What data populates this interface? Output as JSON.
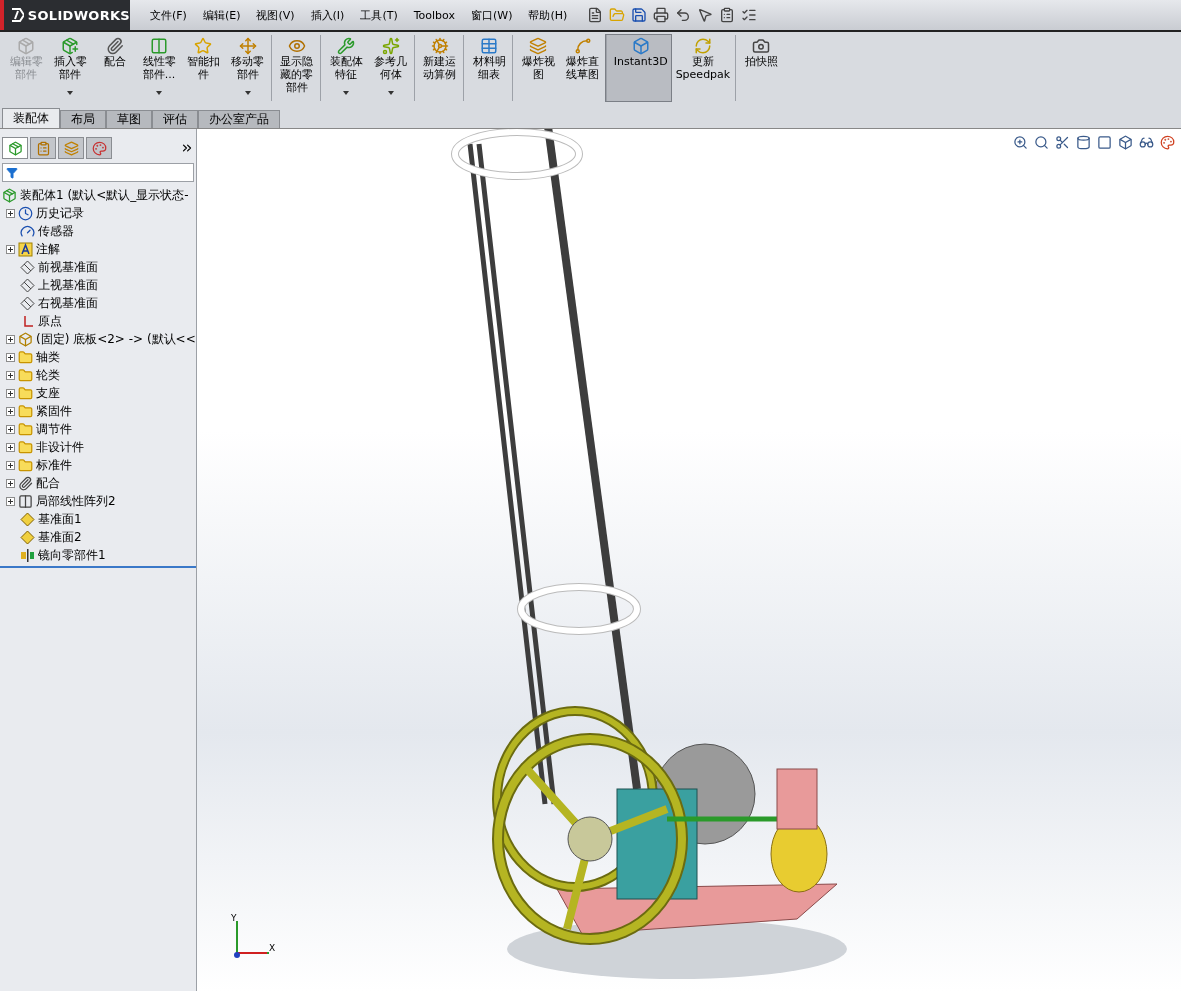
{
  "app": {
    "brand": "SOLIDWORKS"
  },
  "menu": [
    "文件(F)",
    "编辑(E)",
    "视图(V)",
    "插入(I)",
    "工具(T)",
    "Toolbox",
    "窗口(W)",
    "帮助(H)"
  ],
  "commands": [
    {
      "label": "编辑零部件",
      "disabled": true,
      "dropdown": false,
      "selected": false,
      "separator_before": false
    },
    {
      "label": "插入零部件",
      "disabled": false,
      "dropdown": true,
      "selected": false,
      "separator_before": false
    },
    {
      "label": "配合",
      "disabled": false,
      "dropdown": false,
      "selected": false,
      "separator_before": false
    },
    {
      "label": "线性零部件...",
      "disabled": false,
      "dropdown": true,
      "selected": false,
      "separator_before": false
    },
    {
      "label": "智能扣件",
      "disabled": false,
      "dropdown": false,
      "selected": false,
      "separator_before": false
    },
    {
      "label": "移动零部件",
      "disabled": false,
      "dropdown": true,
      "selected": false,
      "separator_before": false
    },
    {
      "label": "显示隐藏的零部件",
      "disabled": false,
      "dropdown": false,
      "selected": false,
      "separator_before": true
    },
    {
      "label": "装配体特征",
      "disabled": false,
      "dropdown": true,
      "selected": false,
      "separator_before": true
    },
    {
      "label": "参考几何体",
      "disabled": false,
      "dropdown": true,
      "selected": false,
      "separator_before": false
    },
    {
      "label": "新建运动算例",
      "disabled": false,
      "dropdown": false,
      "selected": false,
      "separator_before": true
    },
    {
      "label": "材料明细表",
      "disabled": false,
      "dropdown": false,
      "selected": false,
      "separator_before": true
    },
    {
      "label": "爆炸视图",
      "disabled": false,
      "dropdown": false,
      "selected": false,
      "separator_before": true
    },
    {
      "label": "爆炸直线草图",
      "disabled": false,
      "dropdown": false,
      "selected": false,
      "separator_before": false
    },
    {
      "label": "Instant3D",
      "disabled": false,
      "dropdown": false,
      "selected": true,
      "separator_before": true
    },
    {
      "label": "更新Speedpak",
      "disabled": false,
      "dropdown": false,
      "selected": false,
      "separator_before": false
    },
    {
      "label": "拍快照",
      "disabled": false,
      "dropdown": false,
      "selected": false,
      "separator_before": true
    }
  ],
  "tabs": [
    {
      "label": "装配体",
      "selected": true
    },
    {
      "label": "布局",
      "selected": false
    },
    {
      "label": "草图",
      "selected": false
    },
    {
      "label": "评估",
      "selected": false
    },
    {
      "label": "办公室产品",
      "selected": false
    }
  ],
  "panel_tabs": [
    {
      "selected": true
    },
    {
      "selected": false
    },
    {
      "selected": false
    },
    {
      "selected": false
    }
  ],
  "tree": {
    "label": "装配体1 (默认<默认_显示状态-",
    "kind": "assembly",
    "children": [
      {
        "label": "历史记录",
        "kind": "history",
        "expandable": true
      },
      {
        "label": "传感器",
        "kind": "sensor",
        "expandable": false
      },
      {
        "label": "注解",
        "kind": "annotation",
        "expandable": true
      },
      {
        "label": "前视基准面",
        "kind": "plane",
        "expandable": false
      },
      {
        "label": "上视基准面",
        "kind": "plane",
        "expandable": false
      },
      {
        "label": "右视基准面",
        "kind": "plane",
        "expandable": false
      },
      {
        "label": "原点",
        "kind": "origin",
        "expandable": false
      },
      {
        "label": "(固定) 底板<2> -> (默认<<",
        "kind": "part",
        "expandable": true
      },
      {
        "label": "轴类",
        "kind": "folder",
        "expandable": true
      },
      {
        "label": "轮类",
        "kind": "folder",
        "expandable": true
      },
      {
        "label": "支座",
        "kind": "folder",
        "expandable": true
      },
      {
        "label": "紧固件",
        "kind": "folder",
        "expandable": true
      },
      {
        "label": "调节件",
        "kind": "folder",
        "expandable": true
      },
      {
        "label": "非设计件",
        "kind": "folder",
        "expandable": true
      },
      {
        "label": "标准件",
        "kind": "folder",
        "expandable": true
      },
      {
        "label": "配合",
        "kind": "mates",
        "expandable": true
      },
      {
        "label": "局部线性阵列2",
        "kind": "pattern",
        "expandable": true
      },
      {
        "label": "基准面1",
        "kind": "refplane",
        "expandable": false
      },
      {
        "label": "基准面2",
        "kind": "refplane",
        "expandable": false
      },
      {
        "label": "镜向零部件1",
        "kind": "mirror",
        "expandable": false
      }
    ]
  },
  "triad": {
    "x": "X",
    "y": "Y"
  }
}
